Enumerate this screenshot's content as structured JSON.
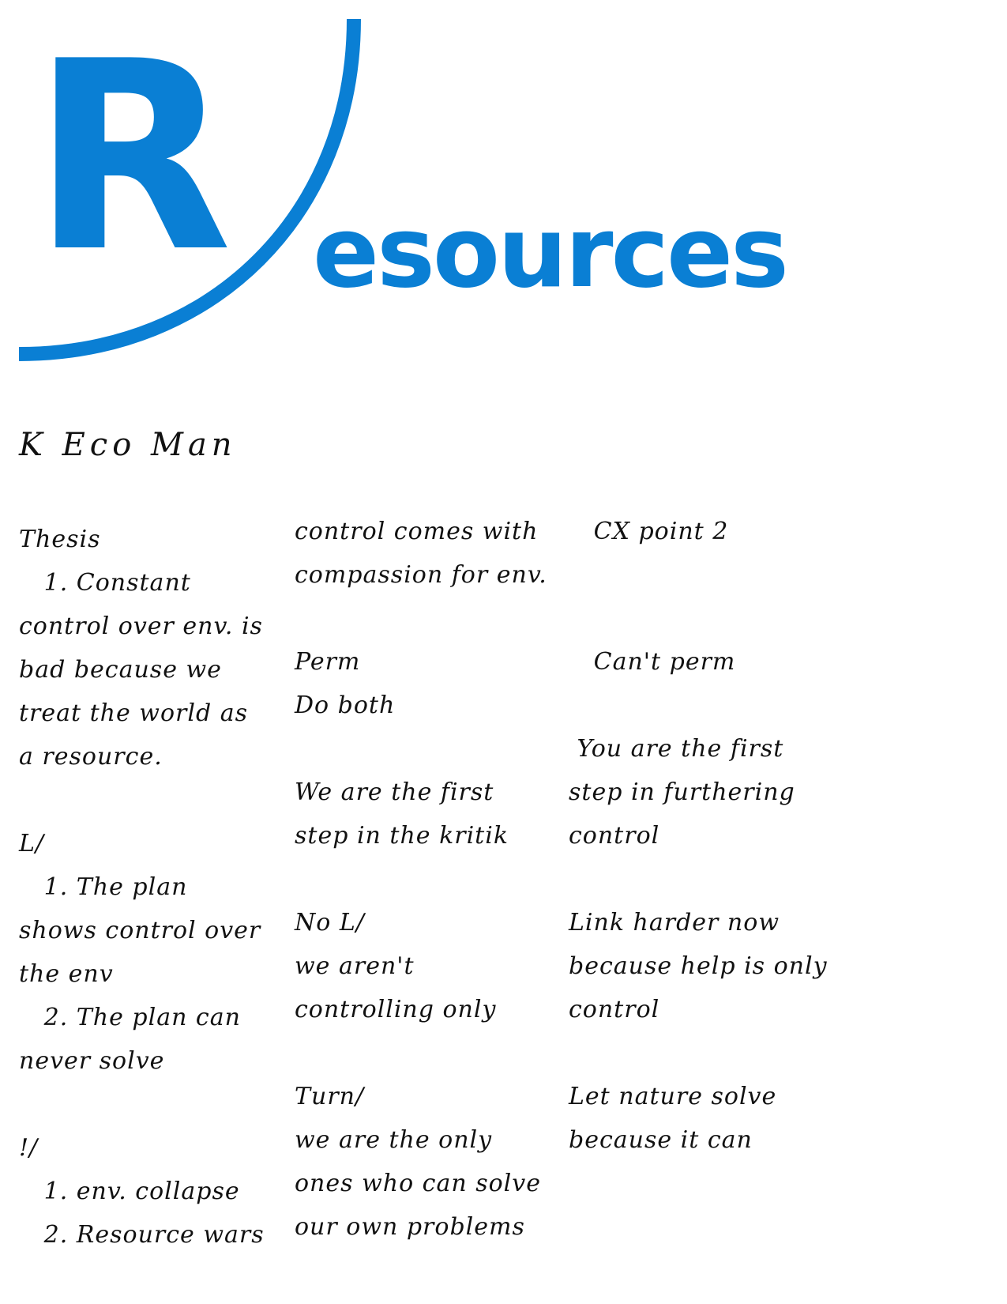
{
  "logo": {
    "letter": "R",
    "word": "esources",
    "color": "#0a7fd4"
  },
  "title": "K Eco Man",
  "columns": [
    [
      "Thesis",
      "   1. Constant",
      "control over env. is",
      "bad because we",
      "treat the world as",
      "a resource.",
      "",
      "L/",
      "   1. The plan",
      "shows control over",
      "the env",
      "   2. The plan can",
      "never solve",
      "",
      "!/",
      "   1. env. collapse",
      "   2. Resource wars"
    ],
    [
      "control comes with",
      "compassion for env.",
      "",
      "Perm",
      "Do both",
      "",
      "We are the first",
      "step in the kritik",
      "",
      "No L/",
      "we aren't",
      "controlling only",
      "",
      "Turn/",
      "we are the only",
      "ones who can solve",
      "our own problems"
    ],
    [
      "   CX point 2",
      "",
      "",
      "   Can't perm",
      "",
      " You are the first",
      "step in furthering",
      "control",
      "",
      "Link harder now",
      "because help is only",
      "control",
      "",
      "Let nature solve",
      "because it can"
    ]
  ]
}
